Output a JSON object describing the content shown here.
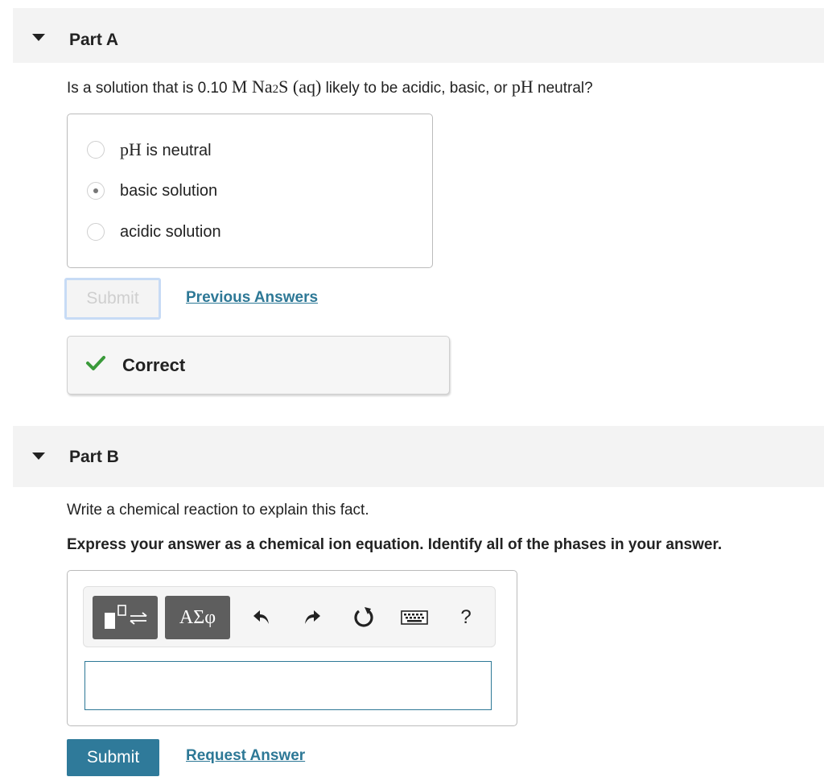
{
  "part_a": {
    "header": "Part A",
    "question": {
      "prefix": "Is a solution that is 0.10 ",
      "m_unit": "M",
      "formula_na": "Na",
      "formula_sub": "2",
      "formula_s": "S",
      "phase": "(aq)",
      "middle": " likely to be acidic, basic, or ",
      "ph": "pH",
      "suffix": " neutral?"
    },
    "choices": [
      {
        "math": "pH",
        "label": " is neutral",
        "selected": false
      },
      {
        "math": "",
        "label": "basic solution",
        "selected": true
      },
      {
        "math": "",
        "label": "acidic solution",
        "selected": false
      }
    ],
    "submit_label": "Submit",
    "previous_answers_label": "Previous Answers",
    "feedback_label": "Correct"
  },
  "part_b": {
    "header": "Part B",
    "prompt": "Write a chemical reaction to explain this fact.",
    "instruction": "Express your answer as a chemical ion equation. Identify all of the phases in your answer.",
    "toolbar": {
      "greek_label": "ΑΣφ",
      "help_label": "?",
      "icons": [
        "templates-icon",
        "greek-letters-icon",
        "undo-icon",
        "redo-icon",
        "reset-icon",
        "keyboard-icon",
        "help-icon"
      ]
    },
    "answer_value": "",
    "submit_label": "Submit",
    "request_answer_label": "Request Answer"
  },
  "colors": {
    "header_bg": "#f3f3f3",
    "link": "#2d7896",
    "primary_button": "#2f7a9a",
    "correct_check": "#3a9a3a",
    "tool_button": "#5e5e5e"
  }
}
